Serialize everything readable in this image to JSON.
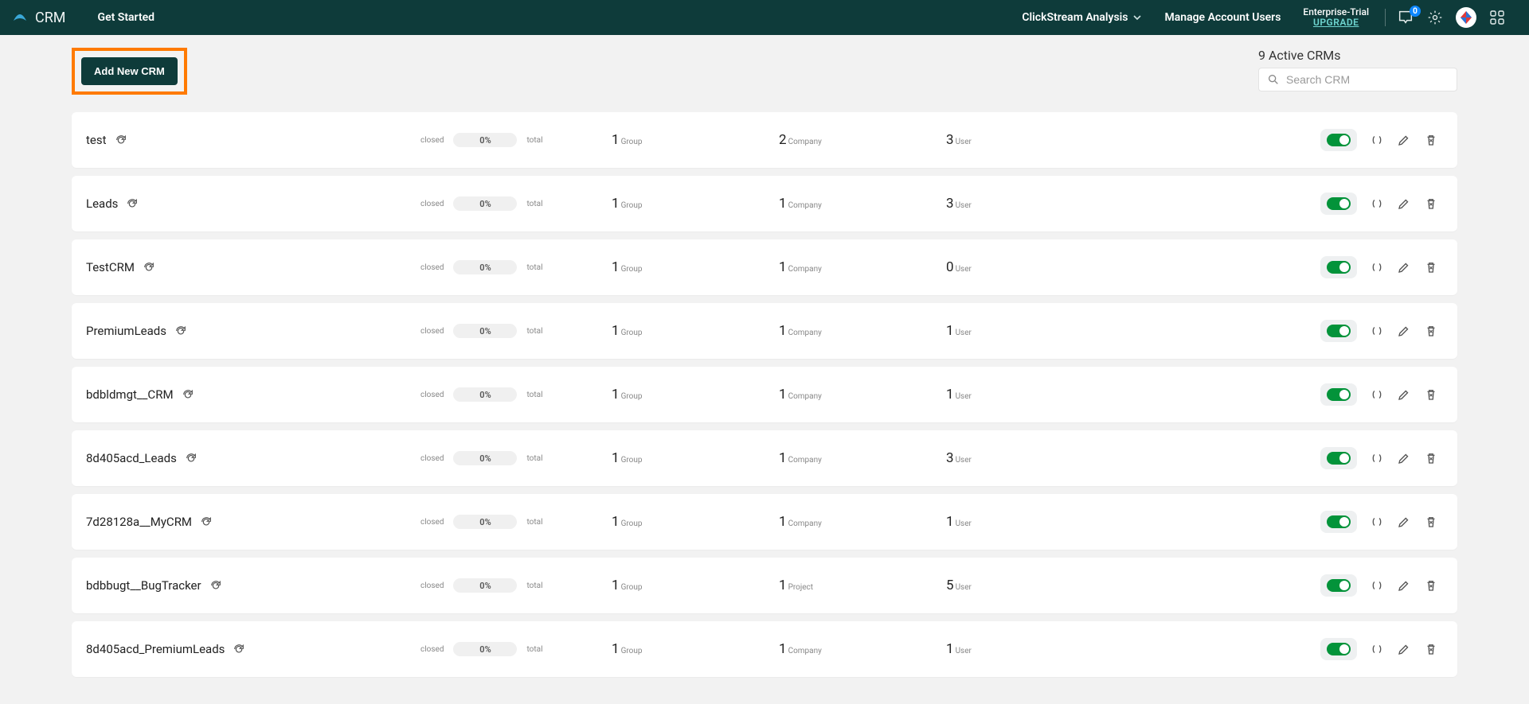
{
  "header": {
    "brand": "CRM",
    "get_started": "Get Started",
    "clickstream": "ClickStream Analysis",
    "manage_users": "Manage Account Users",
    "plan": "Enterprise-Trial",
    "upgrade": "UPGRADE",
    "notif_count": "0"
  },
  "toolbar": {
    "add_label": "Add New CRM",
    "active_crms": "9 Active CRMs",
    "search_placeholder": "Search CRM"
  },
  "labels": {
    "closed": "closed",
    "total": "total",
    "group": "Group",
    "company": "Company",
    "project": "Project",
    "user": "User"
  },
  "rows": [
    {
      "name": "test",
      "pct": "0%",
      "group": "1",
      "mid_num": "2",
      "mid_lbl": "Company",
      "user": "3"
    },
    {
      "name": "Leads",
      "pct": "0%",
      "group": "1",
      "mid_num": "1",
      "mid_lbl": "Company",
      "user": "3"
    },
    {
      "name": "TestCRM",
      "pct": "0%",
      "group": "1",
      "mid_num": "1",
      "mid_lbl": "Company",
      "user": "0"
    },
    {
      "name": "PremiumLeads",
      "pct": "0%",
      "group": "1",
      "mid_num": "1",
      "mid_lbl": "Company",
      "user": "1"
    },
    {
      "name": "bdbldmgt__CRM",
      "pct": "0%",
      "group": "1",
      "mid_num": "1",
      "mid_lbl": "Company",
      "user": "1"
    },
    {
      "name": "8d405acd_Leads",
      "pct": "0%",
      "group": "1",
      "mid_num": "1",
      "mid_lbl": "Company",
      "user": "3"
    },
    {
      "name": "7d28128a__MyCRM",
      "pct": "0%",
      "group": "1",
      "mid_num": "1",
      "mid_lbl": "Company",
      "user": "1"
    },
    {
      "name": "bdbbugt__BugTracker",
      "pct": "0%",
      "group": "1",
      "mid_num": "1",
      "mid_lbl": "Project",
      "user": "5"
    },
    {
      "name": "8d405acd_PremiumLeads",
      "pct": "0%",
      "group": "1",
      "mid_num": "1",
      "mid_lbl": "Company",
      "user": "1"
    }
  ]
}
